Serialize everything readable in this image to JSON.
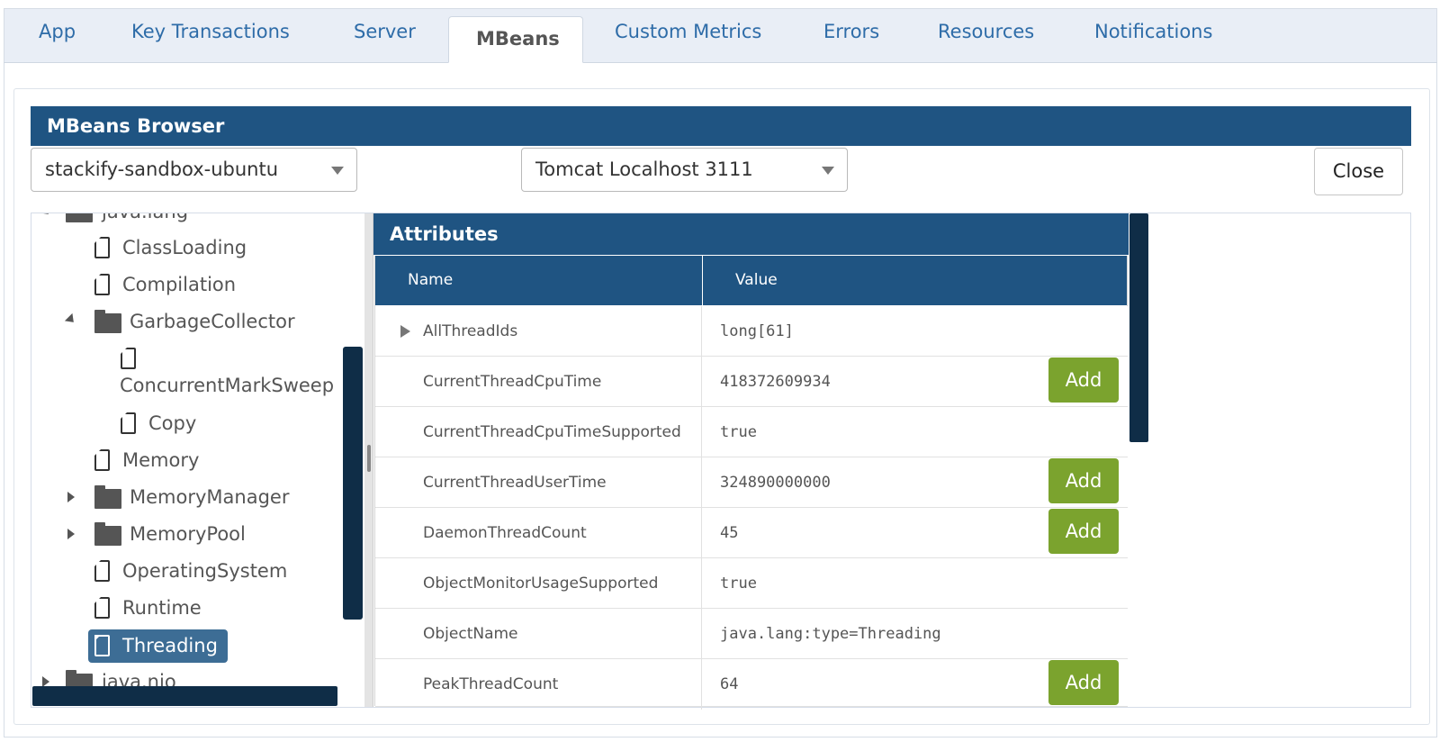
{
  "tabs": [
    {
      "label": "App",
      "active": false
    },
    {
      "label": "Key Transactions",
      "active": false
    },
    {
      "label": "Server",
      "active": false
    },
    {
      "label": "MBeans",
      "active": true
    },
    {
      "label": "Custom Metrics",
      "active": false
    },
    {
      "label": "Errors",
      "active": false
    },
    {
      "label": "Resources",
      "active": false
    },
    {
      "label": "Notifications",
      "active": false
    }
  ],
  "browser": {
    "title": "MBeans Browser",
    "server_select": "stackify-sandbox-ubuntu",
    "app_select": "Tomcat Localhost 3111",
    "close_label": "Close"
  },
  "tree": {
    "items": [
      {
        "label": "java.lang",
        "kind": "folder",
        "expanded": true
      },
      {
        "label": "ClassLoading",
        "kind": "file"
      },
      {
        "label": "Compilation",
        "kind": "file"
      },
      {
        "label": "GarbageCollector",
        "kind": "folder",
        "expanded": true
      },
      {
        "label": "ConcurrentMarkSweep",
        "kind": "file"
      },
      {
        "label": "Copy",
        "kind": "file"
      },
      {
        "label": "Memory",
        "kind": "file"
      },
      {
        "label": "MemoryManager",
        "kind": "folder",
        "expanded": false
      },
      {
        "label": "MemoryPool",
        "kind": "folder",
        "expanded": false
      },
      {
        "label": "OperatingSystem",
        "kind": "file"
      },
      {
        "label": "Runtime",
        "kind": "file"
      },
      {
        "label": "Threading",
        "kind": "file",
        "selected": true
      },
      {
        "label": "java.nio",
        "kind": "folder",
        "expanded": false
      }
    ]
  },
  "attributes": {
    "title": "Attributes",
    "col_name": "Name",
    "col_value": "Value",
    "add_label": "Add",
    "rows": [
      {
        "name": "AllThreadIds",
        "value": "long[61]",
        "expandable": true,
        "addable": false
      },
      {
        "name": "CurrentThreadCpuTime",
        "value": "418372609934",
        "expandable": false,
        "addable": true
      },
      {
        "name": "CurrentThreadCpuTimeSupported",
        "value": "true",
        "expandable": false,
        "addable": false
      },
      {
        "name": "CurrentThreadUserTime",
        "value": "324890000000",
        "expandable": false,
        "addable": true
      },
      {
        "name": "DaemonThreadCount",
        "value": "45",
        "expandable": false,
        "addable": true
      },
      {
        "name": "ObjectMonitorUsageSupported",
        "value": "true",
        "expandable": false,
        "addable": false
      },
      {
        "name": "ObjectName",
        "value": "java.lang:type=Threading",
        "expandable": false,
        "addable": false
      },
      {
        "name": "PeakThreadCount",
        "value": "64",
        "expandable": false,
        "addable": true
      }
    ]
  }
}
